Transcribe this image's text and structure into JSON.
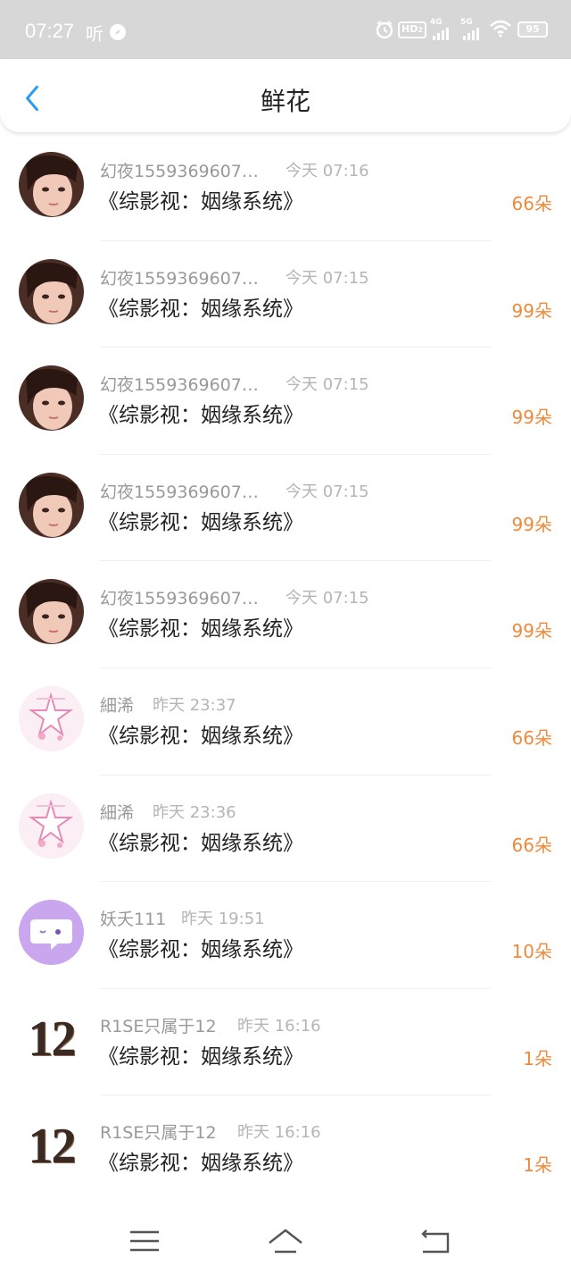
{
  "status_bar": {
    "time": "07:27",
    "ting": "听",
    "hd_label": "HD",
    "hd_sub": "2",
    "net_4g": "4G",
    "net_5g": "5G",
    "battery": "95"
  },
  "header": {
    "title": "鲜花"
  },
  "items": [
    {
      "user": "幻夜1559369607…",
      "time": "今天 07:16",
      "book": "《综影视：姻缘系统》",
      "amount": "66朵",
      "avatar": "girl"
    },
    {
      "user": "幻夜1559369607…",
      "time": "今天 07:15",
      "book": "《综影视：姻缘系统》",
      "amount": "99朵",
      "avatar": "girl"
    },
    {
      "user": "幻夜1559369607…",
      "time": "今天 07:15",
      "book": "《综影视：姻缘系统》",
      "amount": "99朵",
      "avatar": "girl"
    },
    {
      "user": "幻夜1559369607…",
      "time": "今天 07:15",
      "book": "《综影视：姻缘系统》",
      "amount": "99朵",
      "avatar": "girl"
    },
    {
      "user": "幻夜1559369607…",
      "time": "今天 07:15",
      "book": "《综影视：姻缘系统》",
      "amount": "99朵",
      "avatar": "girl"
    },
    {
      "user": "細浠",
      "time": "昨天 23:37",
      "book": "《综影视：姻缘系统》",
      "amount": "66朵",
      "avatar": "star"
    },
    {
      "user": "細浠",
      "time": "昨天 23:36",
      "book": "《综影视：姻缘系统》",
      "amount": "66朵",
      "avatar": "star"
    },
    {
      "user": "妖夭111",
      "time": "昨天 19:51",
      "book": "《综影视：姻缘系统》",
      "amount": "10朵",
      "avatar": "chat"
    },
    {
      "user": "R1SE只属于12",
      "time": "昨天 16:16",
      "book": "《综影视：姻缘系统》",
      "amount": "1朵",
      "avatar": "twelve",
      "avatar_text": "12"
    },
    {
      "user": "R1SE只属于12",
      "time": "昨天 16:16",
      "book": "《综影视：姻缘系统》",
      "amount": "1朵",
      "avatar": "twelve",
      "avatar_text": "12"
    }
  ],
  "colors": {
    "accent": "#2a9df4",
    "amount": "#ef8a3b",
    "status_bg": "#d7d7d7",
    "chat_avatar": "#c9a6ee"
  },
  "nav_icons": [
    "menu-icon",
    "home-icon",
    "back-icon"
  ]
}
